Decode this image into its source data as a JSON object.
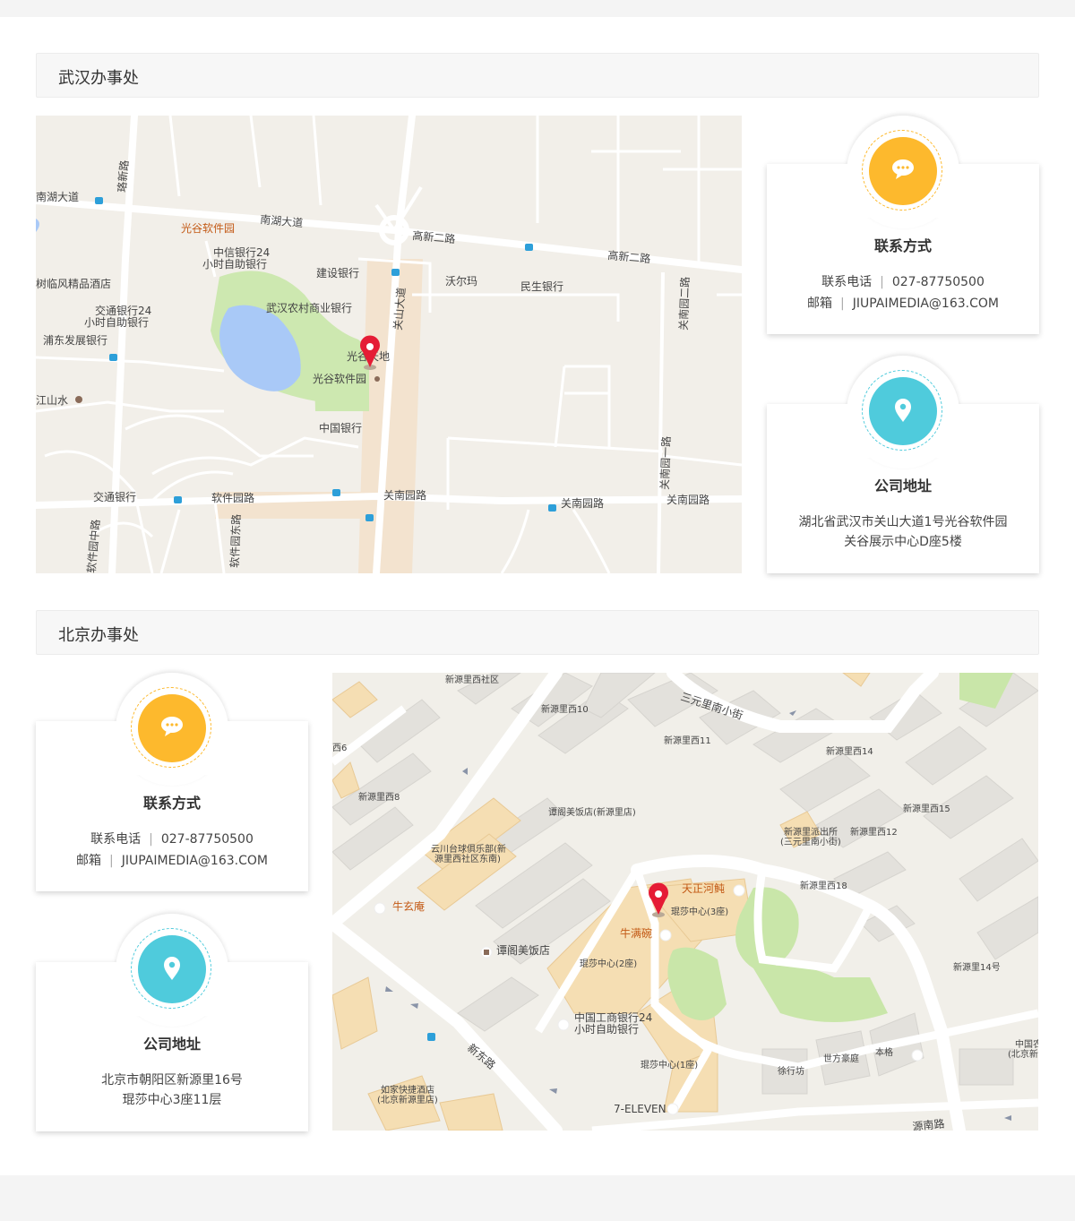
{
  "wuhan": {
    "title": "武汉办事处",
    "contact": {
      "heading": "联系方式",
      "phone_label": "联系电话",
      "phone": "027-87750500",
      "email_label": "邮箱",
      "email": "JIUPAIMEDIA@163.COM",
      "icon": "chat-bubble-icon",
      "color": "#fdb92d"
    },
    "address": {
      "heading": "公司地址",
      "line1": "湖北省武汉市关山大道1号光谷软件园",
      "line2": "关谷展示中心D座5楼",
      "icon": "location-pin-icon",
      "color": "#4fcbdc"
    },
    "map_labels": {
      "nanhu_road_w": "南湖大道",
      "nanhu_road_e": "南湖大道",
      "luoxin_road": "珞新路",
      "gaoxin2_w": "高新二路",
      "gaoxin2_e": "高新二路",
      "gvsp_top": "光谷软件园",
      "citic_atm": "中信银行24",
      "citic_atm2": "小时自助银行",
      "ccb": "建设银行",
      "walmart": "沃尔玛",
      "cmbc": "民生银行",
      "hotel": "树临风精品酒店",
      "commbank_atm": "交通银行24",
      "commbank_atm2": "小时自助银行",
      "rural_bank": "武汉农村商业银行",
      "spdb": "浦东发展银行",
      "guanshan_ave": "关山大道",
      "guangu_tiandi": "光谷天地",
      "gvsp_mid": "光谷软件园",
      "jiangshan": "江山水",
      "boc": "中国银行",
      "bocom": "交通银行",
      "ruanjian_road": "软件园路",
      "guannan_road_1": "关南园路",
      "guannan_road_2": "关南园路",
      "guannan_road_3": "关南园路",
      "guannan1_road": "关南园一路",
      "guannan2_road": "关南园二路",
      "ruanjian_mid": "软件园中路",
      "ruanjian_east": "软件园东路"
    }
  },
  "beijing": {
    "title": "北京办事处",
    "contact": {
      "heading": "联系方式",
      "phone_label": "联系电话",
      "phone": "027-87750500",
      "email_label": "邮箱",
      "email": "JIUPAIMEDIA@163.COM",
      "icon": "chat-bubble-icon",
      "color": "#fdb92d"
    },
    "address": {
      "heading": "公司地址",
      "line1": "北京市朝阳区新源里16号",
      "line2": "琨莎中心3座11层",
      "icon": "location-pin-icon",
      "color": "#4fcbdc"
    },
    "map_labels": {
      "xyl_west_community": "新源里西社区",
      "sanyuanli_south": "三元里南小街",
      "xyl_west10": "新源里西10",
      "xyl_west11": "新源里西11",
      "xyl_west14": "新源里西14",
      "xyl6": "西6",
      "xyl_west8": "新源里西8",
      "tange": "谭阁美饭店(新源里店)",
      "xyl_west15": "新源里西15",
      "police1": "新源里派出所",
      "police2": "(三元里南小街)",
      "xyl_west12": "新源里西12",
      "yunchuan1": "云川台球俱乐部(新",
      "yunchuan2": "源里西社区东南)",
      "tianzheng": "天正河鲀",
      "xyl_west18": "新源里西18",
      "niuxuan": "牛玄庵",
      "kunsha3": "琨莎中心(3座)",
      "niuman": "牛满碗",
      "tange2": "谭阁美饭店",
      "kunsha2": "琨莎中心(2座)",
      "xyl14": "新源里14号",
      "icbc1": "中国工商银行24",
      "icbc2": "小时自助银行",
      "xindong": "新东路",
      "kunsha1": "琨莎中心(1座)",
      "xuxing": "徐行坊",
      "shifang": "世方豪庭",
      "bengge": "本格",
      "zhongguonong": "中国农",
      "beijingxin": "(北京新源",
      "rujia1": "如家快捷酒店",
      "rujia2": "(北京新源里店)",
      "seven": "7-ELEVEN",
      "road_bottom": "源南路"
    }
  }
}
